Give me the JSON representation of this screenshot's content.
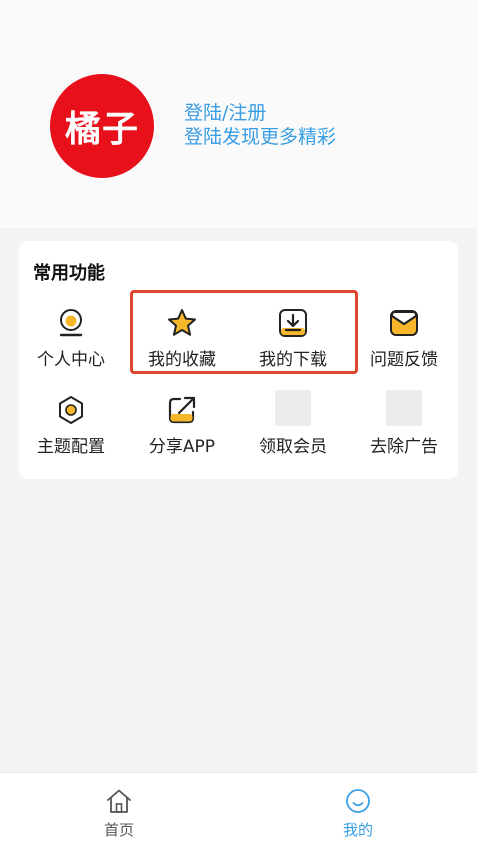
{
  "header": {
    "logo_text": "橘子",
    "login_title": "登陆/注册",
    "login_subtitle": "登陆发现更多精彩"
  },
  "functions": {
    "title": "常用功能",
    "items": [
      {
        "label": "个人中心",
        "icon": "person-icon"
      },
      {
        "label": "我的收藏",
        "icon": "star-icon"
      },
      {
        "label": "我的下载",
        "icon": "download-icon"
      },
      {
        "label": "问题反馈",
        "icon": "mail-icon"
      },
      {
        "label": "主题配置",
        "icon": "hexagon-icon"
      },
      {
        "label": "分享APP",
        "icon": "share-icon"
      },
      {
        "label": "领取会员",
        "icon": "placeholder-icon"
      },
      {
        "label": "去除广告",
        "icon": "placeholder-icon"
      }
    ]
  },
  "tabbar": {
    "tabs": [
      {
        "label": "首页",
        "icon": "home-icon",
        "active": false
      },
      {
        "label": "我的",
        "icon": "smile-icon",
        "active": true
      }
    ]
  },
  "colors": {
    "accent": "#3a9ee4",
    "logo": "#e8101b",
    "icon_yellow": "#f7b72a",
    "highlight": "#e0452d"
  }
}
